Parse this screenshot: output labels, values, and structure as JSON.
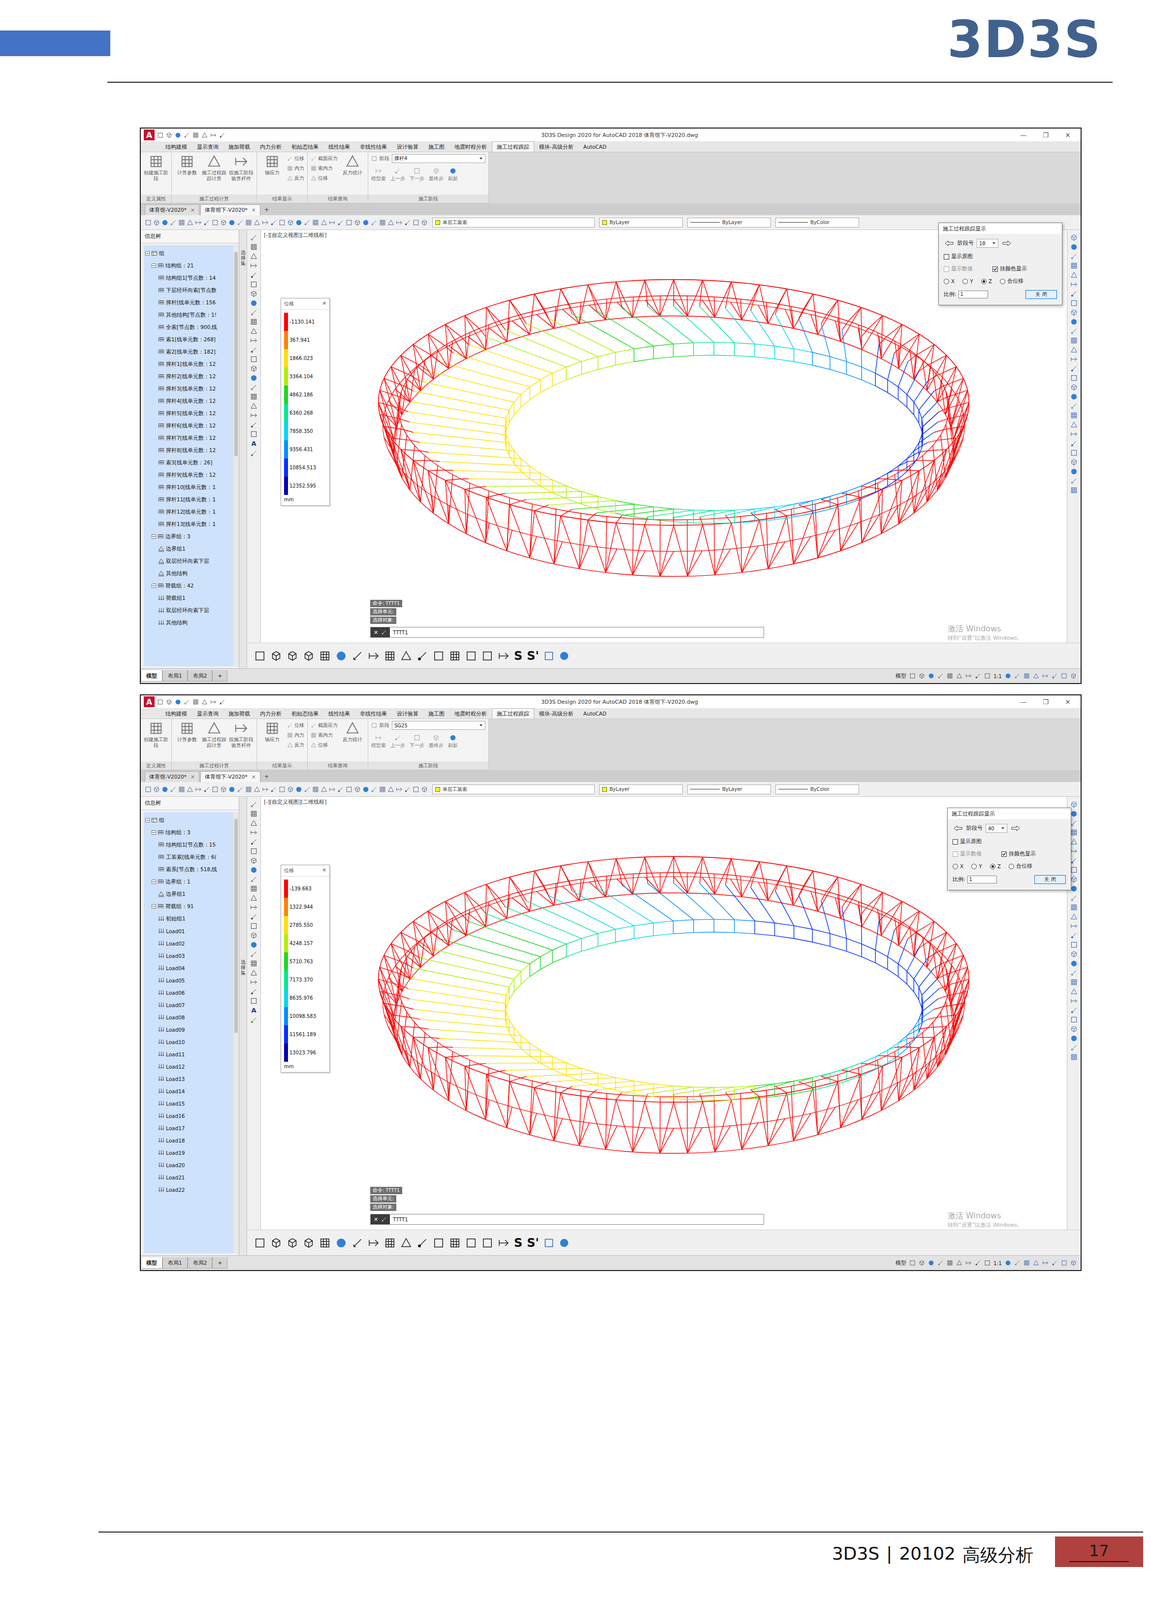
{
  "page": {
    "logo": "3D3S",
    "footer": {
      "brand": "3D3S",
      "separator": "|",
      "code": "20102",
      "section": "高级分析",
      "page": "17"
    }
  },
  "screenshots": [
    {
      "title": "3D3S Design 2020 for AutoCAD 2018   体育馆下-V2020.dwg",
      "app_icon": "A",
      "window_controls": [
        "—",
        "❐",
        "✕"
      ],
      "ribbon_tabs": [
        {
          "label": "结构建模",
          "selected": false
        },
        {
          "label": "显示查询",
          "selected": false
        },
        {
          "label": "施加荷载",
          "selected": false
        },
        {
          "label": "内力分析",
          "selected": false
        },
        {
          "label": "初始态结果",
          "selected": false
        },
        {
          "label": "线性结果",
          "selected": false
        },
        {
          "label": "非线性结果",
          "selected": false
        },
        {
          "label": "设计验算",
          "selected": false
        },
        {
          "label": "施工图",
          "selected": false
        },
        {
          "label": "地震时程分析",
          "selected": false
        },
        {
          "label": "施工过程跟踪",
          "selected": true
        },
        {
          "label": "模块-高级分析",
          "selected": false
        },
        {
          "label": "AutoCAD",
          "selected": false
        }
      ],
      "ribbon_groups": [
        {
          "label": "定义属性",
          "items": [
            {
              "kind": "big",
              "label": "创建施工阶段"
            }
          ]
        },
        {
          "label": "施工过程计算",
          "items": [
            {
              "kind": "big",
              "label": "计算参数"
            },
            {
              "kind": "big",
              "label": "施工过程跟踪计算"
            },
            {
              "kind": "big",
              "label": "按施工阶段验算杆件"
            }
          ]
        },
        {
          "label": "结果显示",
          "items": [
            {
              "kind": "big",
              "label": "轴应力"
            },
            {
              "kind": "small",
              "label": "位移"
            },
            {
              "kind": "small",
              "label": "内力"
            },
            {
              "kind": "small",
              "label": "反力"
            }
          ]
        },
        {
          "label": "结果查询",
          "items": [
            {
              "kind": "small",
              "label": "截面应力"
            },
            {
              "kind": "small",
              "label": "索内力"
            },
            {
              "kind": "small",
              "label": "位移"
            },
            {
              "kind": "big",
              "label": "反力统计"
            }
          ]
        },
        {
          "label": "施工阶段",
          "stage": {
            "label": "阶段",
            "value": "撑杆4"
          },
          "steps": [
            "模型窗",
            "上一步",
            "下一步",
            "最终步",
            "刷新"
          ]
        }
      ],
      "doc_tabs": [
        {
          "label": "体育馆-V2020*",
          "selected": false
        },
        {
          "label": "体育馆下-V2020*",
          "selected": true
        }
      ],
      "tab_close": "×",
      "tab_add": "+",
      "toolbar": {
        "layer": "单层工装索",
        "properties": [
          "ByLayer",
          "ByLayer",
          "ByColor"
        ]
      },
      "tree_header": "信息树",
      "side_label": "选择集",
      "tree": [
        {
          "label": "组",
          "depth": 0,
          "kind": "root",
          "expanded": true
        },
        {
          "label": "结构组：21",
          "depth": 1,
          "kind": "group",
          "expanded": true
        },
        {
          "label": "结构组1[节点数：14",
          "depth": 2,
          "kind": "struct"
        },
        {
          "label": "下层经环向索[节点数",
          "depth": 2,
          "kind": "struct"
        },
        {
          "label": "撑杆[线单元数：156",
          "depth": 2,
          "kind": "struct"
        },
        {
          "label": "其他结构[节点数：1!",
          "depth": 2,
          "kind": "struct"
        },
        {
          "label": "全索[节点数：900,线",
          "depth": 2,
          "kind": "struct"
        },
        {
          "label": "索1[线单元数：268]",
          "depth": 2,
          "kind": "struct"
        },
        {
          "label": "索2[线单元数：182]",
          "depth": 2,
          "kind": "struct"
        },
        {
          "label": "撑杆1[线单元数：12",
          "depth": 2,
          "kind": "struct"
        },
        {
          "label": "撑杆2[线单元数：12",
          "depth": 2,
          "kind": "struct"
        },
        {
          "label": "撑杆3[线单元数：12",
          "depth": 2,
          "kind": "struct"
        },
        {
          "label": "撑杆4[线单元数：12",
          "depth": 2,
          "kind": "struct"
        },
        {
          "label": "撑杆5[线单元数：12",
          "depth": 2,
          "kind": "struct"
        },
        {
          "label": "撑杆6[线单元数：12",
          "depth": 2,
          "kind": "struct"
        },
        {
          "label": "撑杆7[线单元数：12",
          "depth": 2,
          "kind": "struct"
        },
        {
          "label": "撑杆8[线单元数：12",
          "depth": 2,
          "kind": "struct"
        },
        {
          "label": "索3[线单元数：26]",
          "depth": 2,
          "kind": "struct"
        },
        {
          "label": "撑杆9[线单元数：12",
          "depth": 2,
          "kind": "struct"
        },
        {
          "label": "撑杆10[线单元数：1",
          "depth": 2,
          "kind": "struct"
        },
        {
          "label": "撑杆11[线单元数：1",
          "depth": 2,
          "kind": "struct"
        },
        {
          "label": "撑杆12[线单元数：1",
          "depth": 2,
          "kind": "struct"
        },
        {
          "label": "撑杆13[线单元数：1",
          "depth": 2,
          "kind": "struct"
        },
        {
          "label": "边界组：3",
          "depth": 1,
          "kind": "group",
          "expanded": true
        },
        {
          "label": "边界组1",
          "depth": 2,
          "kind": "boundary"
        },
        {
          "label": "双层经环向索下层",
          "depth": 2,
          "kind": "boundary"
        },
        {
          "label": "其他结构",
          "depth": 2,
          "kind": "boundary"
        },
        {
          "label": "荷载组：42",
          "depth": 1,
          "kind": "group",
          "expanded": true
        },
        {
          "label": "荷载组1",
          "depth": 2,
          "kind": "load"
        },
        {
          "label": "双层经环向索下层",
          "depth": 2,
          "kind": "load"
        },
        {
          "label": "其他结构",
          "depth": 2,
          "kind": "load"
        }
      ],
      "view_label": "[-][自定义视图][二维线框]",
      "left_tool_letter": "A",
      "legend": {
        "title": "位移",
        "close": "×",
        "unit": "mm",
        "items": [
          {
            "value": "-1130.141",
            "color": "#ff0000"
          },
          {
            "value": "367.941",
            "color": "#ff8000"
          },
          {
            "value": "1866.023",
            "color": "#ffe000"
          },
          {
            "value": "3364.104",
            "color": "#b0f000"
          },
          {
            "value": "4862.186",
            "color": "#20d820"
          },
          {
            "value": "6360.268",
            "color": "#00e890"
          },
          {
            "value": "7858.350",
            "color": "#00d8f0"
          },
          {
            "value": "9356.431",
            "color": "#0090ff"
          },
          {
            "value": "10854.513",
            "color": "#0030ff"
          },
          {
            "value": "12352.595",
            "color": "#0000b0"
          }
        ]
      },
      "dialog": {
        "title": "施工过程跟踪显示",
        "stage_label": "阶段号",
        "stage": "18",
        "checks": [
          {
            "label": "显示原图",
            "checked": false,
            "disabled": false
          },
          {
            "label": "显示数值",
            "checked": false,
            "disabled": true
          },
          {
            "label": "挂颜色显示",
            "checked": true,
            "disabled": false
          }
        ],
        "radios": [
          {
            "label": "X",
            "selected": false
          },
          {
            "label": "Y",
            "selected": false
          },
          {
            "label": "Z",
            "selected": true
          },
          {
            "label": "合位移",
            "selected": false
          }
        ],
        "scale_label": "比例:",
        "scale": "1",
        "close": "关 闭"
      },
      "command": {
        "history": [
          "命令: TTTT1",
          "选择单元:",
          "选择对象:"
        ],
        "input": "TTTT1",
        "close": "✕"
      },
      "watermark": [
        "激活 Windows",
        "转到“设置”以激活 Windows。"
      ],
      "bottom_letters": [
        "S",
        "S'"
      ],
      "layout_tabs": [
        {
          "label": "模型",
          "selected": true
        },
        {
          "label": "布局1",
          "selected": false
        },
        {
          "label": "布局2",
          "selected": false
        }
      ],
      "layout_add": "+",
      "status": {
        "mode": "模型",
        "scale": "1:1"
      }
    },
    {
      "title": "3D3S Design 2020 for AutoCAD 2018   体育馆下-V2020.dwg",
      "app_icon": "A",
      "window_controls": [
        "—",
        "❐",
        "✕"
      ],
      "ribbon_tabs": [
        {
          "label": "结构建模",
          "selected": false
        },
        {
          "label": "显示查询",
          "selected": false
        },
        {
          "label": "施加荷载",
          "selected": false
        },
        {
          "label": "内力分析",
          "selected": false
        },
        {
          "label": "初始态结果",
          "selected": false
        },
        {
          "label": "线性结果",
          "selected": false
        },
        {
          "label": "非线性结果",
          "selected": false
        },
        {
          "label": "设计验算",
          "selected": false
        },
        {
          "label": "施工图",
          "selected": false
        },
        {
          "label": "地震时程分析",
          "selected": false
        },
        {
          "label": "施工过程跟踪",
          "selected": true
        },
        {
          "label": "模块-高级分析",
          "selected": false
        },
        {
          "label": "AutoCAD",
          "selected": false
        }
      ],
      "ribbon_groups": [
        {
          "label": "定义属性",
          "items": [
            {
              "kind": "big",
              "label": "创建施工阶段"
            }
          ]
        },
        {
          "label": "施工过程计算",
          "items": [
            {
              "kind": "big",
              "label": "计算参数"
            },
            {
              "kind": "big",
              "label": "施工过程跟踪计算"
            },
            {
              "kind": "big",
              "label": "按施工阶段验算杆件"
            }
          ]
        },
        {
          "label": "结果显示",
          "items": [
            {
              "kind": "big",
              "label": "轴应力"
            },
            {
              "kind": "small",
              "label": "位移"
            },
            {
              "kind": "small",
              "label": "内力"
            },
            {
              "kind": "small",
              "label": "反力"
            }
          ]
        },
        {
          "label": "结果查询",
          "items": [
            {
              "kind": "small",
              "label": "截面应力"
            },
            {
              "kind": "small",
              "label": "索内力"
            },
            {
              "kind": "small",
              "label": "位移"
            },
            {
              "kind": "big",
              "label": "反力统计"
            }
          ]
        },
        {
          "label": "施工阶段",
          "stage": {
            "label": "阶段",
            "value": "SG25"
          },
          "steps": [
            "模型窗",
            "上一步",
            "下一步",
            "最终步",
            "刷新"
          ]
        }
      ],
      "doc_tabs": [
        {
          "label": "体育馆-V2020*",
          "selected": false
        },
        {
          "label": "体育馆下-V2020*",
          "selected": true
        }
      ],
      "tab_close": "×",
      "tab_add": "+",
      "toolbar": {
        "layer": "单层工装索",
        "properties": [
          "ByLayer",
          "ByLayer",
          "ByColor"
        ]
      },
      "tree_header": "信息树",
      "side_label": "选择集",
      "tree": [
        {
          "label": "组",
          "depth": 0,
          "kind": "root",
          "expanded": true
        },
        {
          "label": "结构组：3",
          "depth": 1,
          "kind": "group",
          "expanded": true
        },
        {
          "label": "结构组1[节点数：15",
          "depth": 2,
          "kind": "struct"
        },
        {
          "label": "工装索[线单元数：6(",
          "depth": 2,
          "kind": "struct"
        },
        {
          "label": "索系[节点数：518,线",
          "depth": 2,
          "kind": "struct"
        },
        {
          "label": "边界组：1",
          "depth": 1,
          "kind": "group",
          "expanded": true
        },
        {
          "label": "边界组1",
          "depth": 2,
          "kind": "boundary"
        },
        {
          "label": "荷载组：91",
          "depth": 1,
          "kind": "group",
          "expanded": true
        },
        {
          "label": "初始组1",
          "depth": 2,
          "kind": "load"
        },
        {
          "label": "Load01",
          "depth": 2,
          "kind": "load"
        },
        {
          "label": "Load02",
          "depth": 2,
          "kind": "load"
        },
        {
          "label": "Load03",
          "depth": 2,
          "kind": "load"
        },
        {
          "label": "Load04",
          "depth": 2,
          "kind": "load"
        },
        {
          "label": "Load05",
          "depth": 2,
          "kind": "load"
        },
        {
          "label": "Load06",
          "depth": 2,
          "kind": "load"
        },
        {
          "label": "Load07",
          "depth": 2,
          "kind": "load"
        },
        {
          "label": "Load08",
          "depth": 2,
          "kind": "load"
        },
        {
          "label": "Load09",
          "depth": 2,
          "kind": "load"
        },
        {
          "label": "Load10",
          "depth": 2,
          "kind": "load"
        },
        {
          "label": "Load11",
          "depth": 2,
          "kind": "load"
        },
        {
          "label": "Load12",
          "depth": 2,
          "kind": "load"
        },
        {
          "label": "Load13",
          "depth": 2,
          "kind": "load"
        },
        {
          "label": "Load14",
          "depth": 2,
          "kind": "load"
        },
        {
          "label": "Load15",
          "depth": 2,
          "kind": "load"
        },
        {
          "label": "Load16",
          "depth": 2,
          "kind": "load"
        },
        {
          "label": "Load17",
          "depth": 2,
          "kind": "load"
        },
        {
          "label": "Load18",
          "depth": 2,
          "kind": "load"
        },
        {
          "label": "Load19",
          "depth": 2,
          "kind": "load"
        },
        {
          "label": "Load20",
          "depth": 2,
          "kind": "load"
        },
        {
          "label": "Load21",
          "depth": 2,
          "kind": "load"
        },
        {
          "label": "Load22",
          "depth": 2,
          "kind": "load"
        }
      ],
      "view_label": "[-][自定义视图][二维线框]",
      "left_tool_letter": "A",
      "legend": {
        "title": "位移",
        "close": "×",
        "unit": "mm",
        "items": [
          {
            "value": "-139.663",
            "color": "#ff0000"
          },
          {
            "value": "1322.944",
            "color": "#ff8000"
          },
          {
            "value": "2785.550",
            "color": "#ffe000"
          },
          {
            "value": "4248.157",
            "color": "#b0f000"
          },
          {
            "value": "5710.763",
            "color": "#20d820"
          },
          {
            "value": "7173.370",
            "color": "#00e890"
          },
          {
            "value": "8635.976",
            "color": "#00d8f0"
          },
          {
            "value": "10098.583",
            "color": "#0090ff"
          },
          {
            "value": "11561.189",
            "color": "#0030ff"
          },
          {
            "value": "13023.796",
            "color": "#0000b0"
          }
        ]
      },
      "dialog": {
        "title": "施工过程跟踪显示",
        "stage_label": "阶段号",
        "stage": "40",
        "checks": [
          {
            "label": "显示原图",
            "checked": false,
            "disabled": false
          },
          {
            "label": "显示数值",
            "checked": false,
            "disabled": true
          },
          {
            "label": "挂颜色显示",
            "checked": true,
            "disabled": false
          }
        ],
        "radios": [
          {
            "label": "X",
            "selected": false
          },
          {
            "label": "Y",
            "selected": false
          },
          {
            "label": "Z",
            "selected": true
          },
          {
            "label": "合位移",
            "selected": false
          }
        ],
        "scale_label": "比例:",
        "scale": "1",
        "close": "关 闭"
      },
      "command": {
        "history": [
          "命令: TTTT1",
          "选择单元:",
          "选择对象:"
        ],
        "input": "TTTT1",
        "close": "✕"
      },
      "watermark": [
        "激活 Windows",
        "转到“设置”以激活 Windows。"
      ],
      "bottom_letters": [
        "S",
        "S'"
      ],
      "layout_tabs": [
        {
          "label": "模型",
          "selected": true
        },
        {
          "label": "布局1",
          "selected": false
        },
        {
          "label": "布局2",
          "selected": false
        }
      ],
      "layout_add": "+",
      "status": {
        "mode": "模型",
        "scale": "1:1"
      }
    }
  ]
}
